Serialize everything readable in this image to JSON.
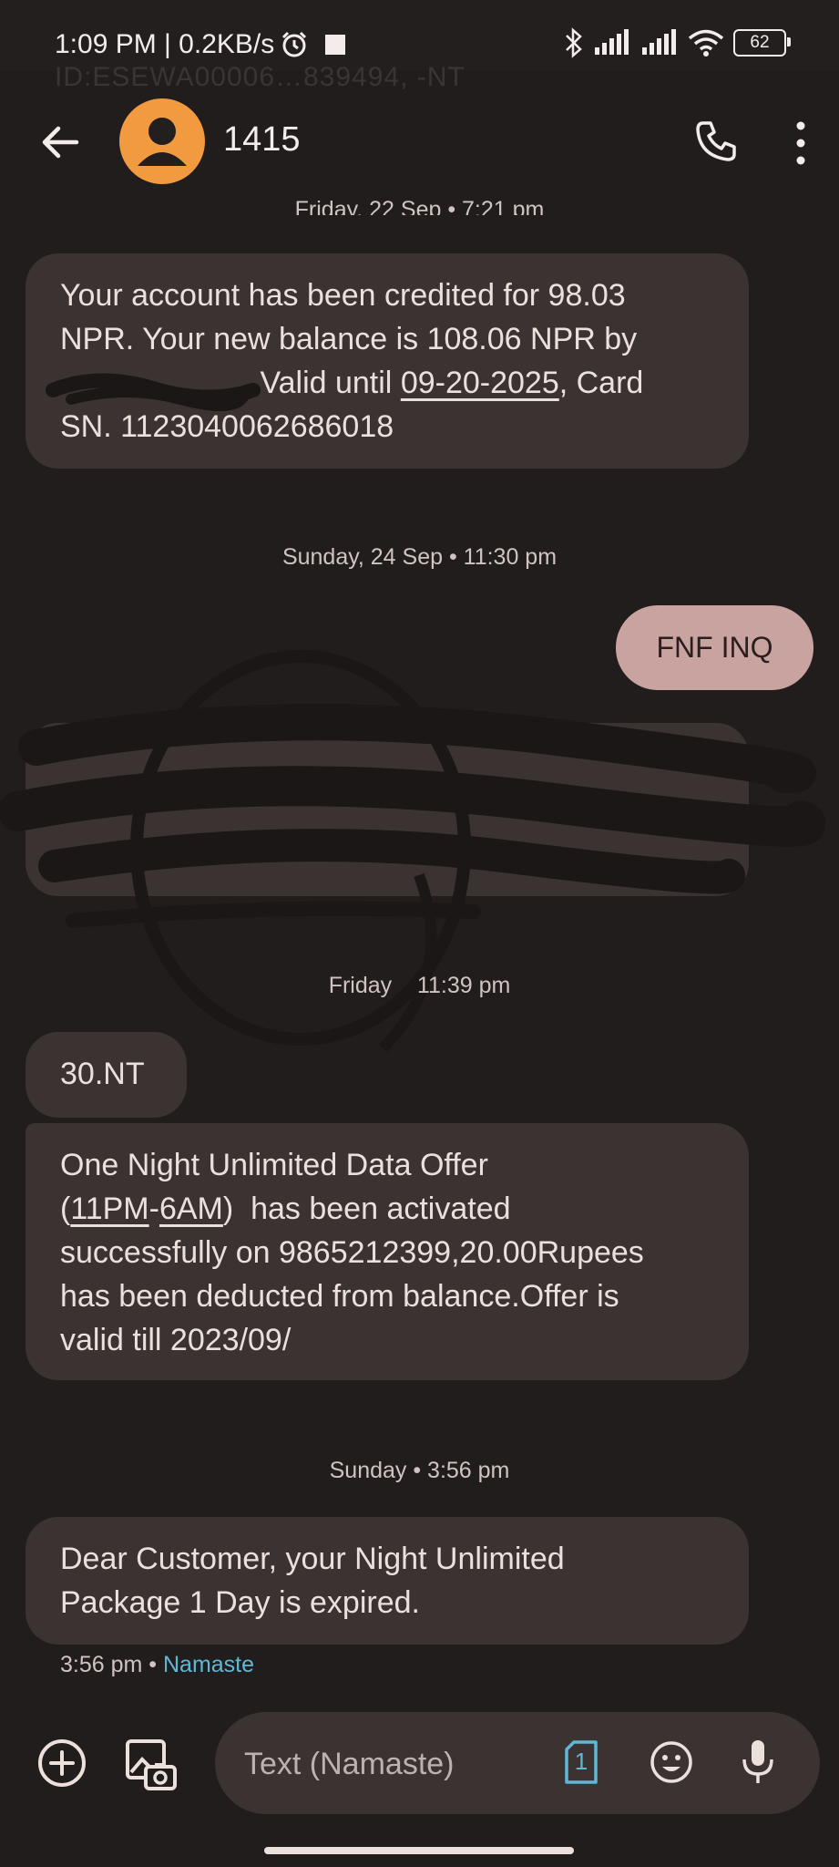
{
  "status_bar": {
    "time": "1:09 PM | 0.2KB/s",
    "battery": "62",
    "ghost_text": "ID:ESEWA00006…839494, -NT"
  },
  "header": {
    "contact_name": "1415"
  },
  "thread": {
    "msg1": {
      "timestamp": "Friday, 22 Sep • 7:21 pm",
      "line1": "Your account has been credited for 98.03",
      "line2": "NPR. Your new balance is 108.06 NPR by",
      "line3_valid": "Valid until",
      "line3_date": "09-20-2025",
      "line3_end": ", Card",
      "line4": "SN. 1123040062686018"
    },
    "day2": "Sunday, 24 Sep • 11:30 pm",
    "sent_msg": "FNF INQ",
    "day3": "Friday    11:39 pm",
    "short_msg": "30.NT",
    "offer": {
      "line1": "One Night Unlimited Data Offer",
      "paren_open": "(",
      "time_a": "11PM",
      "dash": "-",
      "time_b": "6AM",
      "line2_end": ")  has been activated",
      "line3": "successfully on 9865212399,20.00Rupees",
      "line4": "has been deducted from balance.Offer is",
      "line5": "valid till 2023/09/"
    },
    "day4": "Sunday • 3:56 pm",
    "last_msg": {
      "line1": "Dear Customer, your Night Unlimited",
      "line2": "Package 1 Day is expired."
    },
    "meta_time": "3:56 pm",
    "meta_sep": " • ",
    "meta_sim": "Namaste"
  },
  "composer": {
    "placeholder": "Text (Namaste)",
    "sim_number": "1"
  },
  "colors": {
    "background": "#211d1c",
    "incoming_bubble": "#3a3331",
    "outgoing_bubble": "#c9a3a0",
    "avatar": "#f29a3f",
    "sim_accent": "#5fb8d6"
  }
}
